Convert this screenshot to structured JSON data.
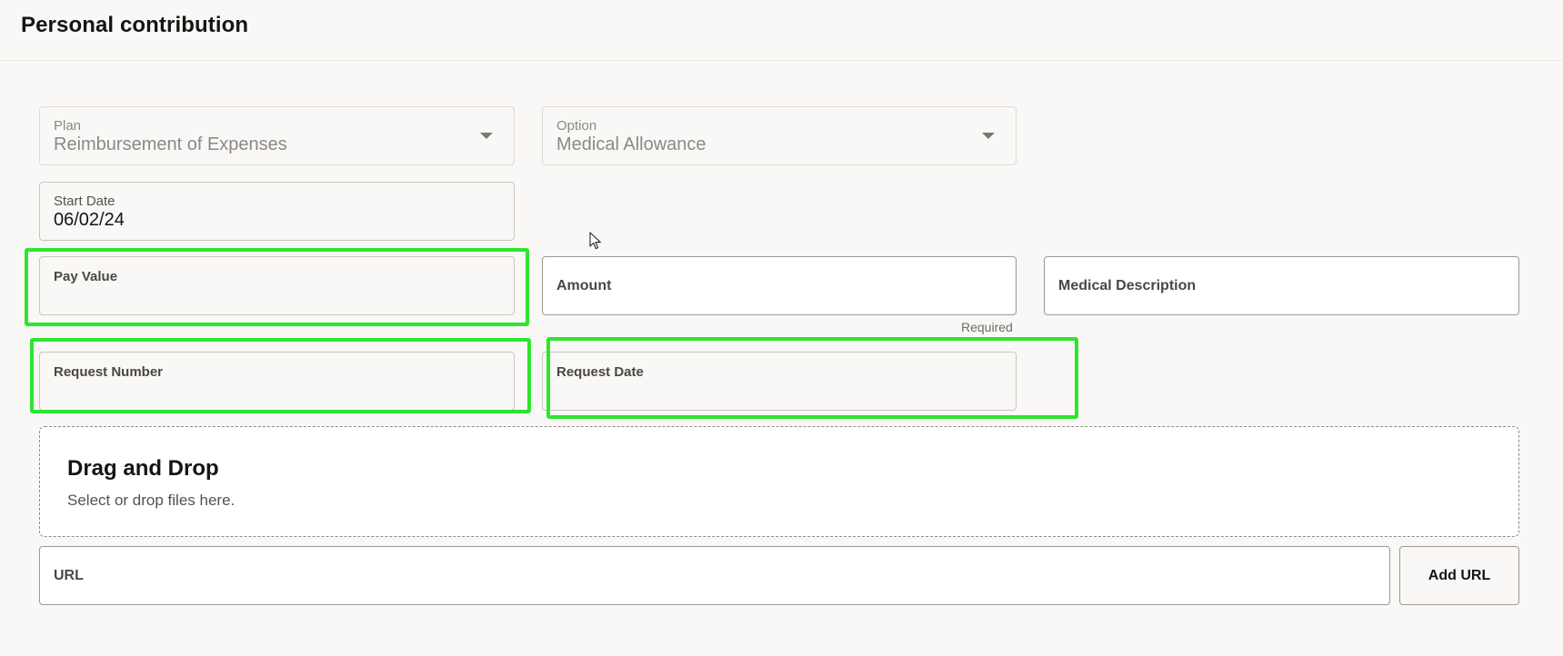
{
  "page": {
    "title": "Personal contribution"
  },
  "form": {
    "plan": {
      "label": "Plan",
      "value": "Reimbursement of Expenses"
    },
    "option": {
      "label": "Option",
      "value": "Medical Allowance"
    },
    "start_date": {
      "label": "Start Date",
      "value": "06/02/24"
    },
    "pay_value": {
      "label": "Pay Value",
      "value": ""
    },
    "amount": {
      "label": "Amount",
      "value": "",
      "hint": "Required"
    },
    "medical_description": {
      "label": "Medical Description",
      "value": ""
    },
    "request_number": {
      "label": "Request Number",
      "value": ""
    },
    "request_date": {
      "label": "Request Date",
      "value": ""
    }
  },
  "attachments": {
    "dropzone_title": "Drag and Drop",
    "dropzone_subtitle": "Select or drop files here.",
    "url_label": "URL",
    "add_url_label": "Add URL"
  },
  "icons": {
    "dropdown": "chevron-down-icon",
    "cursor": "mouse-pointer-icon"
  },
  "colors": {
    "highlight": "#2ee52e",
    "background": "#f9f8f6"
  }
}
